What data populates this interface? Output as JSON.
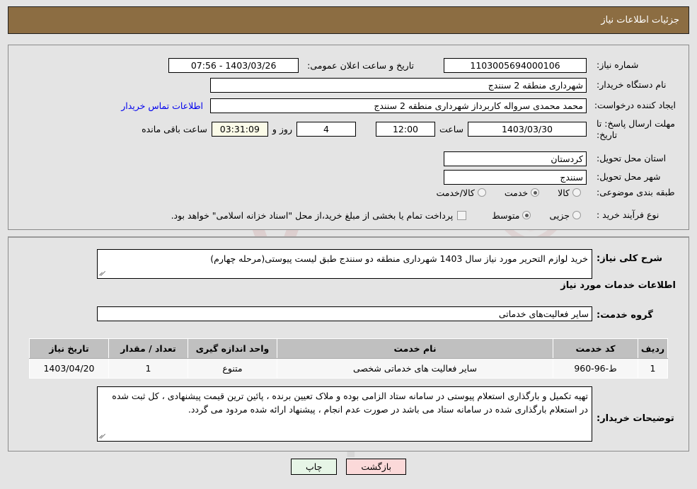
{
  "header": {
    "title": "جزئیات اطلاعات نیاز"
  },
  "info": {
    "need_number_label": "شماره نیاز:",
    "need_number_value": "1103005694000106",
    "public_announce_label": "تاریخ و ساعت اعلان عمومی:",
    "public_announce_value": "1403/03/26 - 07:56",
    "buyer_org_label": "نام دستگاه خریدار:",
    "buyer_org_value": "شهرداری منطقه 2 سنندج",
    "requester_label": "ایجاد کننده درخواست:",
    "requester_value": "محمد محمدی سرواله کاربرداز شهرداری منطقه 2 سنندج",
    "buyer_contact_link": "اطلاعات تماس خریدار",
    "deadline_label": "مهلت ارسال پاسخ: تا تاریخ:",
    "deadline_date": "1403/03/30",
    "hour_label": "ساعت",
    "deadline_hour": "12:00",
    "days_remaining": "4",
    "days_and_label": "روز و",
    "countdown": "03:31:09",
    "countdown_suffix": "ساعت باقی مانده",
    "province_label": "استان محل تحویل:",
    "province_value": "کردستان",
    "city_label": "شهر محل تحویل:",
    "city_value": "سنندج",
    "category_label": "طبقه بندی موضوعی:",
    "category_options": [
      {
        "label": "کالا",
        "selected": false
      },
      {
        "label": "خدمت",
        "selected": true
      },
      {
        "label": "کالا/خدمت",
        "selected": false
      }
    ],
    "process_label": "نوع فرآیند خرید :",
    "process_options": [
      {
        "label": "جزیی",
        "selected": false
      },
      {
        "label": "متوسط",
        "selected": true
      }
    ],
    "treasury_checkbox_checked": false,
    "treasury_note": "پرداخت تمام یا بخشی از مبلغ خرید،از محل \"اسناد خزانه اسلامی\" خواهد بود."
  },
  "details": {
    "general_desc_label": "شرح کلی نیاز:",
    "general_desc_value": "خرید لوازم التحریر مورد نیاز سال 1403 شهرداری منطقه دو سنندج طبق لیست پیوستی(مرحله چهارم)",
    "services_section_title": "اطلاعات خدمات مورد نیاز",
    "service_group_label": "گروه خدمت:",
    "service_group_value": "سایر فعالیت‌های خدماتی",
    "buyer_notes_label": "توضیحات خریدار:",
    "buyer_notes_value": "تهیه  تکمیل و بارگذاری استعلام پیوستی در سامانه ستاد الزامی بوده و ملاک تعیین برنده ، پائین ترین قیمت پیشنهادی ، کل ثبت شده در استعلام بارگذاری شده در سامانه ستاد می باشد در صورت عدم انجام ، پیشنهاد ارائه شده مردود می گردد."
  },
  "table": {
    "columns": [
      "ردیف",
      "کد خدمت",
      "نام خدمت",
      "واحد اندازه گیری",
      "تعداد / مقدار",
      "تاریخ نیاز"
    ],
    "rows": [
      {
        "index": "1",
        "service_code": "ط-96-960",
        "service_name": "سایر فعالیت های خدماتی شخصی",
        "unit": "متنوع",
        "quantity": "1",
        "need_date": "1403/04/20"
      }
    ]
  },
  "buttons": {
    "print": "چاپ",
    "back": "بازگشت"
  },
  "watermark": {
    "brand": "AriaTender.net"
  },
  "colors": {
    "header_bar": "#8c6d42",
    "page_bg": "#e4e4e4",
    "link": "#0000ee",
    "print_btn": "#e6f5e6",
    "back_btn": "#fbd9d9",
    "table_header": "#c0c0c0",
    "countdown_field": "#fbfbe8"
  }
}
